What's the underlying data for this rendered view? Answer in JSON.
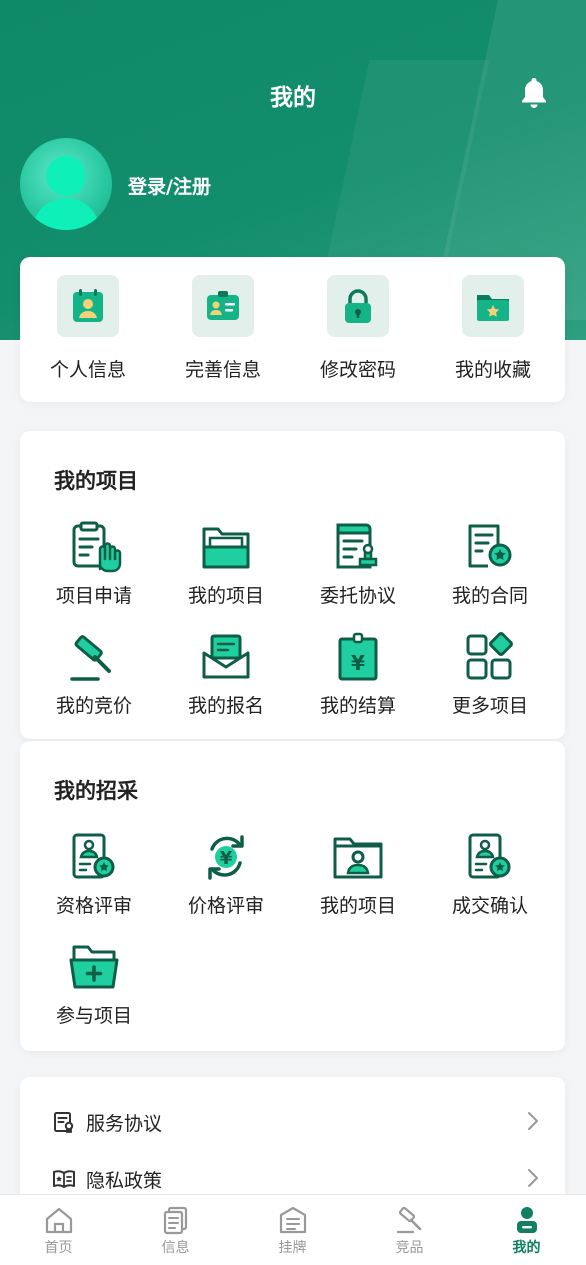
{
  "header": {
    "title": "我的",
    "login_label": "登录/注册"
  },
  "quick_actions": [
    {
      "label": "个人信息",
      "icon": "id-badge-icon"
    },
    {
      "label": "完善信息",
      "icon": "id-card-icon"
    },
    {
      "label": "修改密码",
      "icon": "lock-icon"
    },
    {
      "label": "我的收藏",
      "icon": "star-folder-icon"
    }
  ],
  "projects": {
    "title": "我的项目",
    "items": [
      {
        "label": "项目申请",
        "icon": "hand-clipboard-icon"
      },
      {
        "label": "我的项目",
        "icon": "folder-icon"
      },
      {
        "label": "委托协议",
        "icon": "stamp-document-icon"
      },
      {
        "label": "我的合同",
        "icon": "contract-badge-icon"
      },
      {
        "label": "我的竞价",
        "icon": "gavel-icon"
      },
      {
        "label": "我的报名",
        "icon": "envelope-icon"
      },
      {
        "label": "我的结算",
        "icon": "yuan-receipt-icon"
      },
      {
        "label": "更多项目",
        "icon": "grid-more-icon"
      }
    ]
  },
  "procurement": {
    "title": "我的招采",
    "items": [
      {
        "label": "资格评审",
        "icon": "qualification-review-icon"
      },
      {
        "label": "价格评审",
        "icon": "yuan-cycle-icon"
      },
      {
        "label": "我的项目",
        "icon": "person-folder-icon"
      },
      {
        "label": "成交确认",
        "icon": "deal-confirm-icon"
      },
      {
        "label": "参与项目",
        "icon": "folder-add-icon"
      }
    ]
  },
  "menu": [
    {
      "label": "服务协议",
      "icon": "agreement-icon"
    },
    {
      "label": "隐私政策",
      "icon": "privacy-book-icon"
    }
  ],
  "tabbar": [
    {
      "label": "首页",
      "icon": "home-icon"
    },
    {
      "label": "信息",
      "icon": "documents-icon"
    },
    {
      "label": "挂牌",
      "icon": "listing-icon"
    },
    {
      "label": "竞品",
      "icon": "gavel-icon"
    },
    {
      "label": "我的",
      "icon": "user-icon",
      "active": true
    }
  ],
  "colors": {
    "brand": "#127f61",
    "header_bg": "#138e6d",
    "accent_light": "#1fcf9f",
    "icon_bg": "#e3efea",
    "tab_inactive": "#999999"
  }
}
